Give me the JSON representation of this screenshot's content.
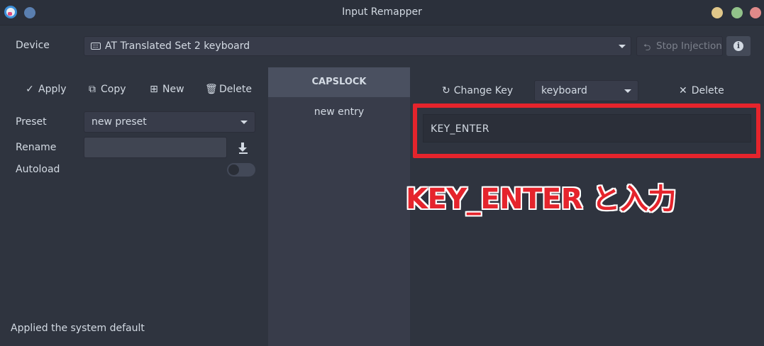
{
  "window": {
    "title": "Input Remapper"
  },
  "device": {
    "label": "Device",
    "selected": "AT Translated Set 2 keyboard",
    "stop_injection_label": "Stop Injection"
  },
  "toolbar": {
    "apply_label": "Apply",
    "copy_label": "Copy",
    "new_label": "New",
    "delete_label": "Delete"
  },
  "preset": {
    "label": "Preset",
    "selected": "new preset",
    "rename_label": "Rename",
    "rename_value": "",
    "autoload_label": "Autoload",
    "autoload_on": false
  },
  "mappings": {
    "selected_key": "CAPSLOCK",
    "entries": [
      "new entry"
    ]
  },
  "editor": {
    "change_key_label": "Change Key",
    "target_type": "keyboard",
    "delete_label": "Delete",
    "output_value": "KEY_ENTER"
  },
  "annotation": {
    "text": "KEY_ENTER と入力",
    "color": "#e5242c"
  },
  "status": {
    "text": "Applied the system default"
  }
}
